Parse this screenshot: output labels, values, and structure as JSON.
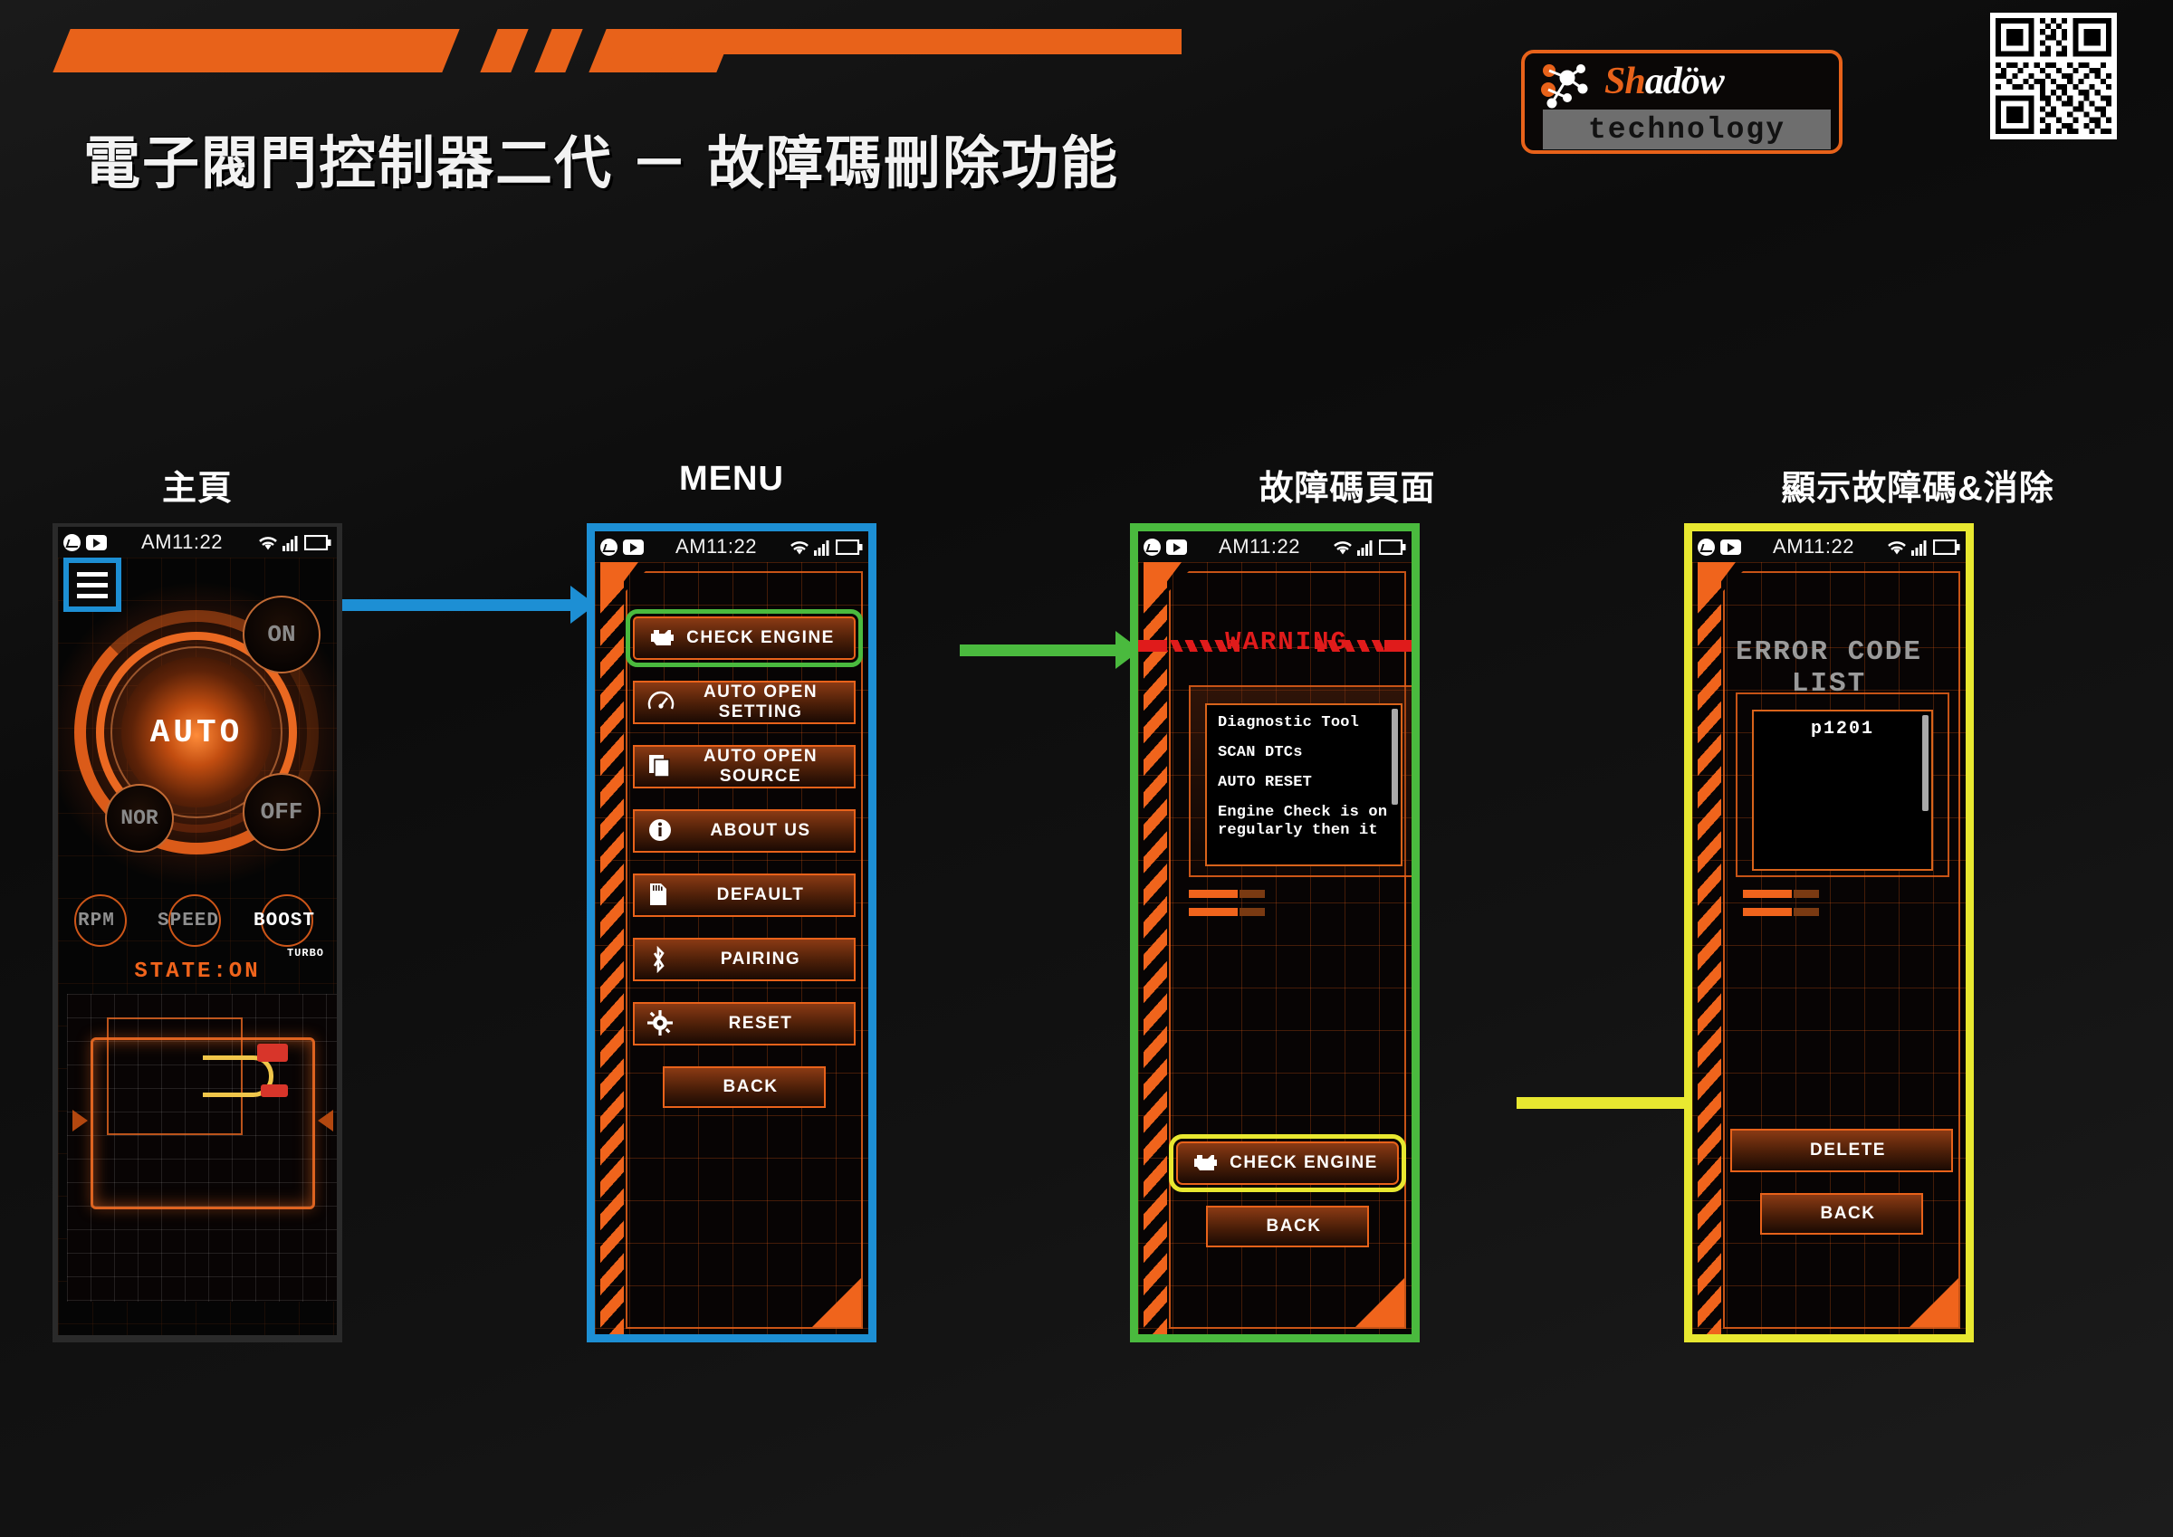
{
  "header": {
    "title": "電子閥門控制器二代 － 故障碼刪除功能",
    "logo": {
      "brand_prefix": "Sh",
      "brand_suffix": "adöw",
      "tagline": "technology"
    },
    "accent_color": "#e8621a"
  },
  "columns": [
    {
      "label": "主頁"
    },
    {
      "label": "MENU"
    },
    {
      "label": "故障碼頁面"
    },
    {
      "label": "顯示故障碼&消除"
    }
  ],
  "statusbar": {
    "time": "AM11:22",
    "icons": [
      "messenger-icon",
      "youtube-icon",
      "wifi-icon",
      "signal-icon",
      "battery-icon"
    ]
  },
  "screen_home": {
    "menu_icon": "hamburger-icon",
    "dial_mode": "AUTO",
    "buttons": {
      "on": "ON",
      "off": "OFF",
      "nor": "NOR"
    },
    "gauges": {
      "rpm": "RPM",
      "speed": "SPEED",
      "boost": "BOOST",
      "boost_sub": "TURBO"
    },
    "state": "STATE:ON",
    "highlight_color": "#1d8fd4"
  },
  "screen_menu": {
    "items": [
      {
        "label": "CHECK ENGINE",
        "icon": "engine-icon",
        "highlight": "#4aba3e"
      },
      {
        "label": "AUTO OPEN SETTING",
        "icon": "gauge-icon"
      },
      {
        "label": "AUTO OPEN SOURCE",
        "icon": "documents-icon"
      },
      {
        "label": "ABOUT US",
        "icon": "info-icon"
      },
      {
        "label": "DEFAULT",
        "icon": "sdcard-icon"
      },
      {
        "label": "PAIRING",
        "icon": "bluetooth-icon"
      },
      {
        "label": "RESET",
        "icon": "gear-icon"
      }
    ],
    "back": "BACK",
    "border_color": "#1d8fd4"
  },
  "screen_warning": {
    "banner": "WARNING",
    "banner_color": "#e01b1b",
    "lines": [
      "Diagnostic Tool",
      "SCAN DTCs",
      "AUTO RESET",
      "Engine Check is on regularly then it"
    ],
    "check_engine": "CHECK ENGINE",
    "back": "BACK",
    "border_color": "#4aba3e",
    "highlight_color": "#e8e830"
  },
  "screen_errorlist": {
    "title": "ERROR CODE LIST",
    "codes": [
      "p1201"
    ],
    "delete": "DELETE",
    "back": "BACK",
    "border_color": "#e8e830"
  }
}
